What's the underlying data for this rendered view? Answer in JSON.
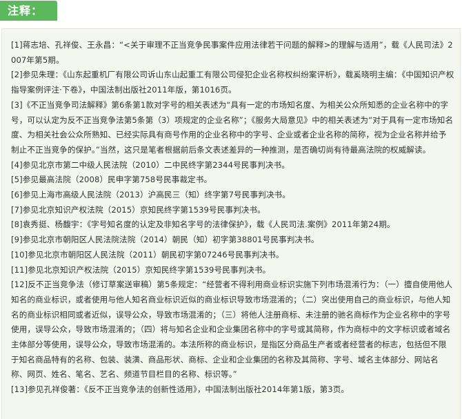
{
  "header": {
    "title": "注释："
  },
  "notes": [
    "[1]蒋志培、孔祥俊、王永昌：“<关于审理不正当竞争民事案件应用法律若干问题的解释>的理解与适用”，载《人民司法》2007年第5期。",
    "[2]参见朱理：《山东起重机厂有限公司诉山东山起重工有限公司侵犯企业名称权纠纷案评析》，载奚晓明主编：《中国知识产权指导案例评注·下卷》，中国法制出版社2011年版，第1016页。",
    "[3]《不正当竞争司法解释》第6条第1款对字号的相关表述为“具有一定的市场知名度、为相关公众所知悉的企业名称中的字号，可以认定为反不正当竞争法第5条第（3）项规定的企业名称”；《服务大局意见》中的相关表述为“对于具有一定市场知名度、为相关社会公众所熟知、已经实际具有商号作用的企业名称中的字号、企业或者企业名称的简称，视为企业名称并给予制止不正当竞争的保护。”当然，这只是笔者根据前后条文表述差异的一种推测，是否确切尚有待最高法院的权威解读。",
    "[4]参见北京市第二中级人民法院（2010）二中民终字第2344号民事判决书。",
    "[5]参见最高法院（2008）民申字第758号民事裁定书。",
    "[6]参见上海市高级人民法院（2013）沪高民三（知）终字第7号民事判决书。",
    "[7]参见北京知识产权法院（2015）京知民终字第1539号民事判决书。",
    "[8]袁秀挺、杨馥宇：《字号知名度的认定及非知名字号的法律保护》，载《人民司法.案例》2011年第24期。",
    "[9]参见北京市朝阳区人民法院法院（2014）朝民（知）初字第38801号民事判决书。",
    "[10]参见北京市朝阳区人民法院（2011）朝民初字第07246号民事判决书。",
    "[11]参见北京知识产权法院（2015）京知民终字第1539号民事判决书。",
    "[12]反不正当竞争法（修订草案送审稿）第5条规定：“经营者不得利用商业标识实施下列市场混淆行为：（一）擅自使用他人知名的商业标识，或者使用与他人知名商业标识近似的商业标识导致市场混淆的；（二）突出使用自己的商业标识，与他人知名的商业标识相同或者近似，误导公众，导致市场混淆的；（三）将他人注册商标、未注册的驰名商标作为企业名称中的字号使用，误导公众，导致市场混淆的；（四）将与知名企业和企业集团名称中的字号或其简称，作为商标中的文字标识或者域名主体部分等使用，误导公众，导致市场混淆的。本法所称的商业标识，是指区分商品生产者或者经营者的标志，包括但不限于知名商品特有的名称、包装、装潢、商品形状、商标、企业和企业集团的名称及其简称、字号、域名主体部分、网站名称、网页、姓名、笔名、艺名、频道节目栏目的名称、标识等。”",
    "[13]参见孔祥俊著：《反不正当竞争法的创新性适用》，中国法制出版社2014年第1版，第3页。"
  ]
}
